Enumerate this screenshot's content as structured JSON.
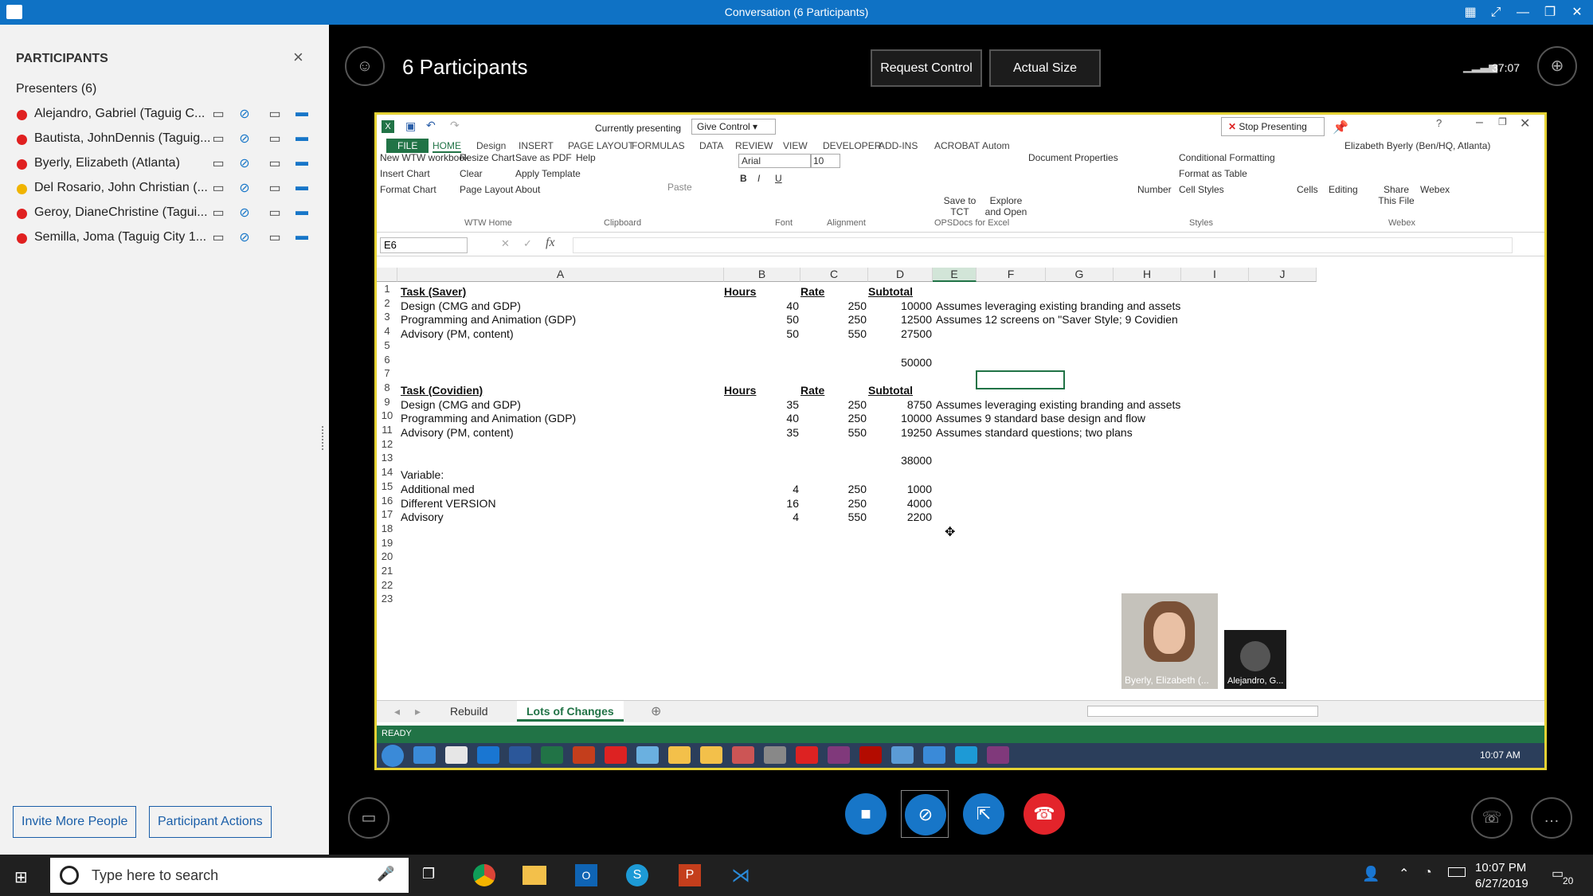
{
  "window": {
    "title": "Conversation (6 Participants)"
  },
  "participants_panel": {
    "header": "PARTICIPANTS",
    "presenters_label": "Presenters (6)",
    "people": [
      {
        "name": "Alejandro, Gabriel (Taguig C...",
        "status_color": "#e02020"
      },
      {
        "name": "Bautista, JohnDennis (Taguig...",
        "status_color": "#e02020"
      },
      {
        "name": "Byerly, Elizabeth (Atlanta)",
        "status_color": "#e02020"
      },
      {
        "name": "Del Rosario, John Christian (...",
        "status_color": "#f0b400"
      },
      {
        "name": "Geroy, DianeChristine (Tagui...",
        "status_color": "#e02020"
      },
      {
        "name": "Semilla, Joma (Taguig City 1...",
        "status_color": "#e02020"
      }
    ],
    "invite_button": "Invite More People",
    "actions_button": "Participant Actions"
  },
  "stage": {
    "participants_title": "6 Participants",
    "request_control": "Request Control",
    "actual_size": "Actual Size",
    "call_timer": "37:07",
    "video_labels": [
      "Byerly, Elizabeth (...",
      "Alejandro, G..."
    ]
  },
  "excel": {
    "presenting_label": "Currently presenting",
    "give_control": "Give Control",
    "stop_presenting": "Stop Presenting",
    "user": "Elizabeth Byerly (Ben/HQ, Atlanta)",
    "tabs": [
      "FILE",
      "HOME",
      "Design",
      "INSERT",
      "PAGE LAYOUT",
      "FORMULAS",
      "DATA",
      "REVIEW",
      "VIEW",
      "DEVELOPER",
      "ADD-INS",
      "ACROBAT",
      "Autom"
    ],
    "wtw_items": [
      "New WTW workbook",
      "Resize Chart",
      "Save as PDF",
      "Help",
      "Insert Chart",
      "Clear",
      "Apply Template",
      "Format Chart",
      "Page Layout",
      "About"
    ],
    "groups": [
      "WTW Home",
      "Clipboard",
      "Font",
      "Alignment",
      "OPSDocs for Excel",
      "Styles",
      "Webex"
    ],
    "paste": "Paste",
    "font_name": "Arial",
    "font_size": "10",
    "save_to_tct": "Save to TCT",
    "explore_open": "Explore and Open",
    "doc_props": "Document Properties",
    "number": "Number",
    "cond_format": "Conditional Formatting",
    "format_table": "Format as Table",
    "cell_styles": "Cell Styles",
    "cells": "Cells",
    "editing": "Editing",
    "share_file": "Share This File",
    "webex": "Webex",
    "name_box": "E6",
    "columns": [
      "A",
      "B",
      "C",
      "D",
      "E",
      "F",
      "G",
      "H",
      "I",
      "J"
    ],
    "rows": [
      [
        "Task (Saver)",
        "Hours",
        "Rate",
        "Subtotal",
        ""
      ],
      [
        "Design (CMG and GDP)",
        "40",
        "250",
        "10000",
        "Assumes leveraging existing branding and assets"
      ],
      [
        "Programming and Animation (GDP)",
        "50",
        "250",
        "12500",
        "Assumes 12 screens on \"Saver Style; 9 Covidien"
      ],
      [
        "Advisory (PM, content)",
        "50",
        "550",
        "27500",
        ""
      ],
      [
        "",
        "",
        "",
        "",
        ""
      ],
      [
        "",
        "",
        "",
        "50000",
        ""
      ],
      [
        "",
        "",
        "",
        "",
        ""
      ],
      [
        "Task (Covidien)",
        "Hours",
        "Rate",
        "Subtotal",
        ""
      ],
      [
        "Design (CMG and GDP)",
        "35",
        "250",
        "8750",
        "Assumes leveraging existing branding and assets"
      ],
      [
        "Programming and Animation (GDP)",
        "40",
        "250",
        "10000",
        "Assumes 9 standard base design and flow"
      ],
      [
        "Advisory (PM, content)",
        "35",
        "550",
        "19250",
        "Assumes standard questions; two plans"
      ],
      [
        "",
        "",
        "",
        "",
        ""
      ],
      [
        "",
        "",
        "",
        "38000",
        ""
      ],
      [
        "Variable:",
        "",
        "",
        "",
        ""
      ],
      [
        "Additional med",
        "4",
        "250",
        "1000",
        ""
      ],
      [
        "Different VERSION",
        "16",
        "250",
        "4000",
        ""
      ],
      [
        "Advisory",
        "4",
        "550",
        "2200",
        ""
      ]
    ],
    "sheet_tabs": [
      "Rebuild",
      "Lots of Changes"
    ],
    "status": "READY",
    "win7_time": "10:07 AM"
  },
  "taskbar": {
    "search_placeholder": "Type here to search",
    "time": "10:07 PM",
    "date": "6/27/2019",
    "notifications": "20"
  }
}
